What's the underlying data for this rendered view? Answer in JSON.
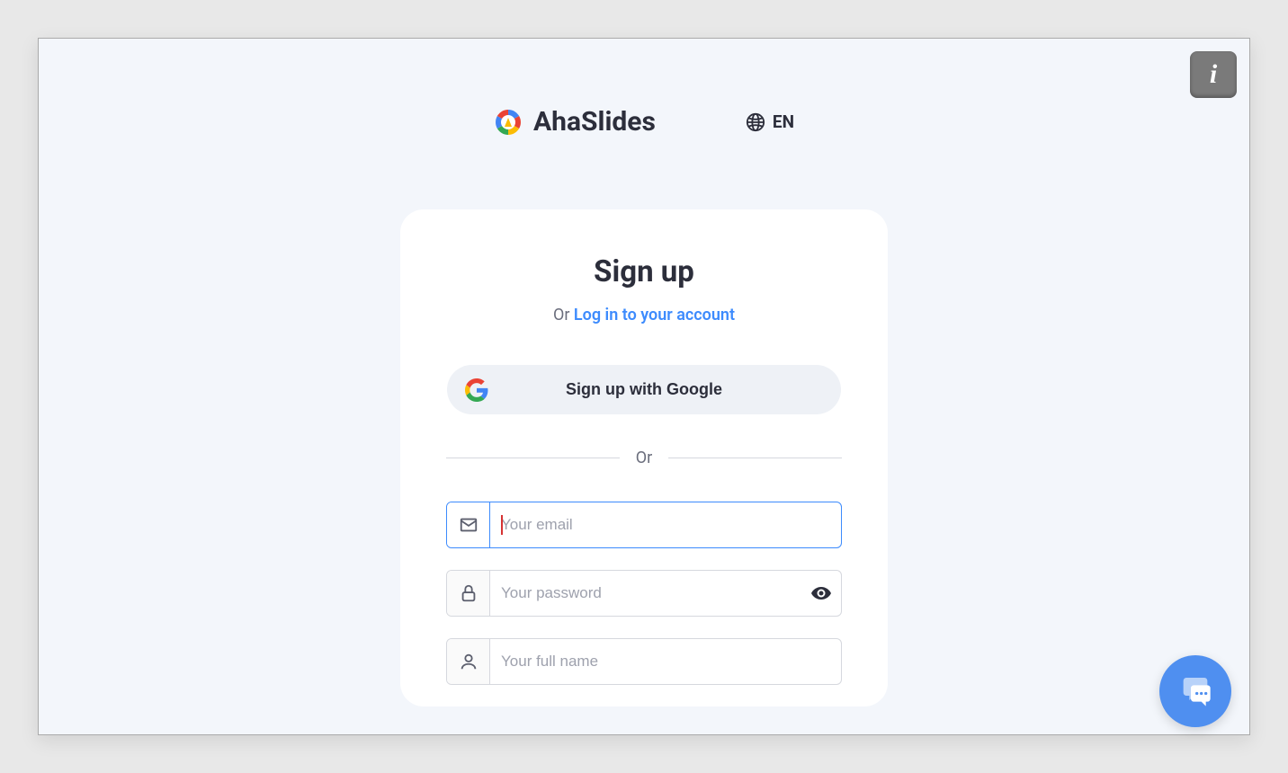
{
  "header": {
    "brand_name": "AhaSlides",
    "language_code": "EN"
  },
  "card": {
    "title": "Sign up",
    "subtitle_prefix": "Or ",
    "subtitle_link": "Log in to your account",
    "google_button_label": "Sign up with Google",
    "divider_text": "Or",
    "inputs": {
      "email_placeholder": "Your email",
      "password_placeholder": "Your password",
      "fullname_placeholder": "Your full name"
    }
  },
  "info_badge": "i"
}
